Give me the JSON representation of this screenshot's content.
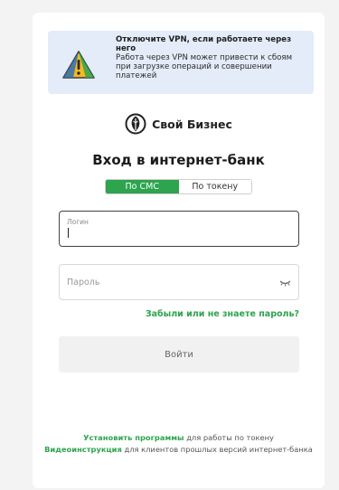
{
  "vpn_banner": {
    "title": "Отключите VPN, если работаете через него",
    "body": "Работа через VPN может привести к сбоям при загрузке операций и совершении платежей"
  },
  "brand": {
    "name": "Свой Бизнес"
  },
  "page_title": "Вход в интернет-банк",
  "tabs": [
    {
      "label": "По СМС",
      "active": true
    },
    {
      "label": "По токену",
      "active": false
    }
  ],
  "login_field": {
    "label": "Логин",
    "value": ""
  },
  "password_field": {
    "placeholder": "Пароль",
    "value": ""
  },
  "forgot_link": "Забыли или не знаете пароль?",
  "login_button": "Войти",
  "footer": {
    "install_link": "Установить программы",
    "install_rest": "для работы по токену",
    "video_link": "Видеоинструкция",
    "video_rest": "для клиентов прошлых версий интернет-банка"
  },
  "colors": {
    "accent_green": "#2ea44f",
    "banner_bg": "#e3ecf8",
    "warning_yellow": "#f5b921"
  },
  "icons": [
    "warning-triangle-icon",
    "bank-logo-icon",
    "eye-closed-icon"
  ]
}
